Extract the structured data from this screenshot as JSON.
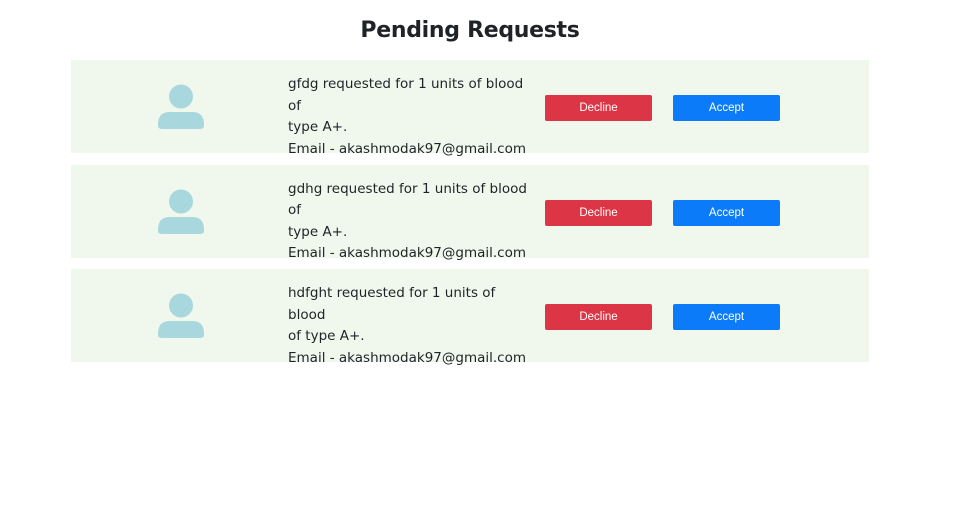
{
  "page": {
    "title": "Pending Requests"
  },
  "colors": {
    "card_background": "#f0f8ee",
    "avatar": "#a8d8dd",
    "decline": "#dc3545",
    "accept": "#0b7bfa"
  },
  "requests": [
    {
      "name": "gfdg",
      "message_line1": "gfdg requested for 1 units of blood of",
      "message_line2": "type A+.",
      "email_line": "Email - akashmodak97@gmail.com",
      "avatar_icon": "user-avatar-icon",
      "decline_label": "Decline",
      "accept_label": "Accept"
    },
    {
      "name": "gdhg",
      "message_line1": "gdhg requested for 1 units of blood of",
      "message_line2": "type A+.",
      "email_line": "Email - akashmodak97@gmail.com",
      "avatar_icon": "user-avatar-icon",
      "decline_label": "Decline",
      "accept_label": "Accept"
    },
    {
      "name": "hdfght",
      "message_line1": "hdfght requested for 1 units of blood",
      "message_line2": "of type A+.",
      "email_line": "Email - akashmodak97@gmail.com",
      "avatar_icon": "user-avatar-icon",
      "decline_label": "Decline",
      "accept_label": "Accept"
    }
  ]
}
